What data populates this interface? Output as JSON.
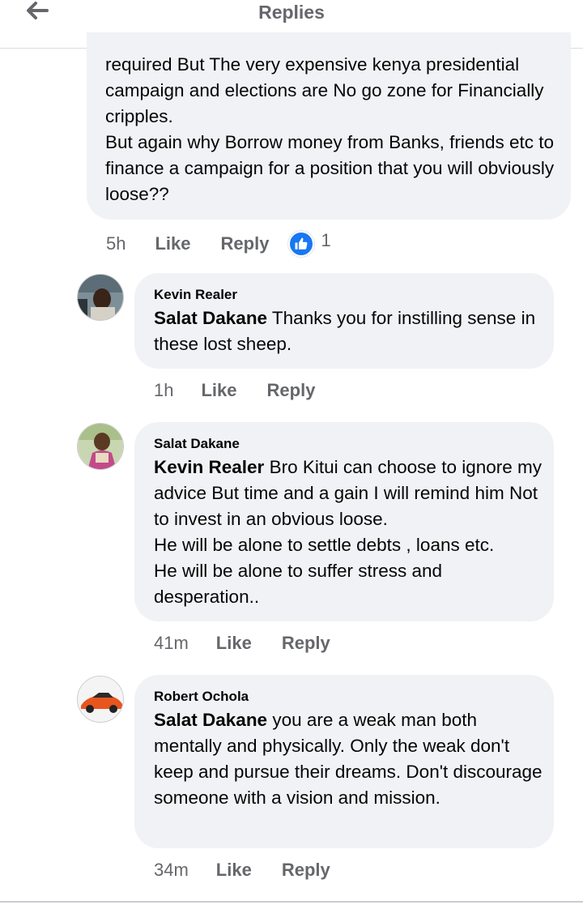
{
  "header": {
    "title": "Replies"
  },
  "top_comment": {
    "text": "required But The very expensive kenya presidential campaign and elections are  No go zone for Financially cripples.\nBut again why Borrow money from Banks, friends etc to finance a campaign for a position that you will obviously loose??",
    "time": "5h",
    "like_label": "Like",
    "reply_label": "Reply",
    "reaction_count": "1"
  },
  "comments": [
    {
      "author": "Kevin Realer",
      "mention": "Salat Dakane",
      "text": " Thanks you for instilling sense in these lost sheep.",
      "time": "1h",
      "like_label": "Like",
      "reply_label": "Reply"
    },
    {
      "author": "Salat Dakane",
      "mention": "Kevin Realer",
      "text": "  Bro Kitui can choose to ignore my advice But time and a gain I will remind him Not to invest in an obvious loose.\nHe will be alone  to settle debts , loans etc.\nHe will be alone to suffer stress and desperation..",
      "time": "41m",
      "like_label": "Like",
      "reply_label": "Reply"
    },
    {
      "author": "Robert Ochola",
      "mention": "Salat Dakane",
      "text": " you are a weak man both mentally and physically. Only the weak don't keep and pursue their dreams. Don't discourage someone with a vision and mission.",
      "time": "34m",
      "like_label": "Like",
      "reply_label": "Reply"
    }
  ],
  "colors": {
    "like_blue": "#1877f2",
    "bubble_bg": "#f0f2f5",
    "meta_gray": "#65676b"
  }
}
